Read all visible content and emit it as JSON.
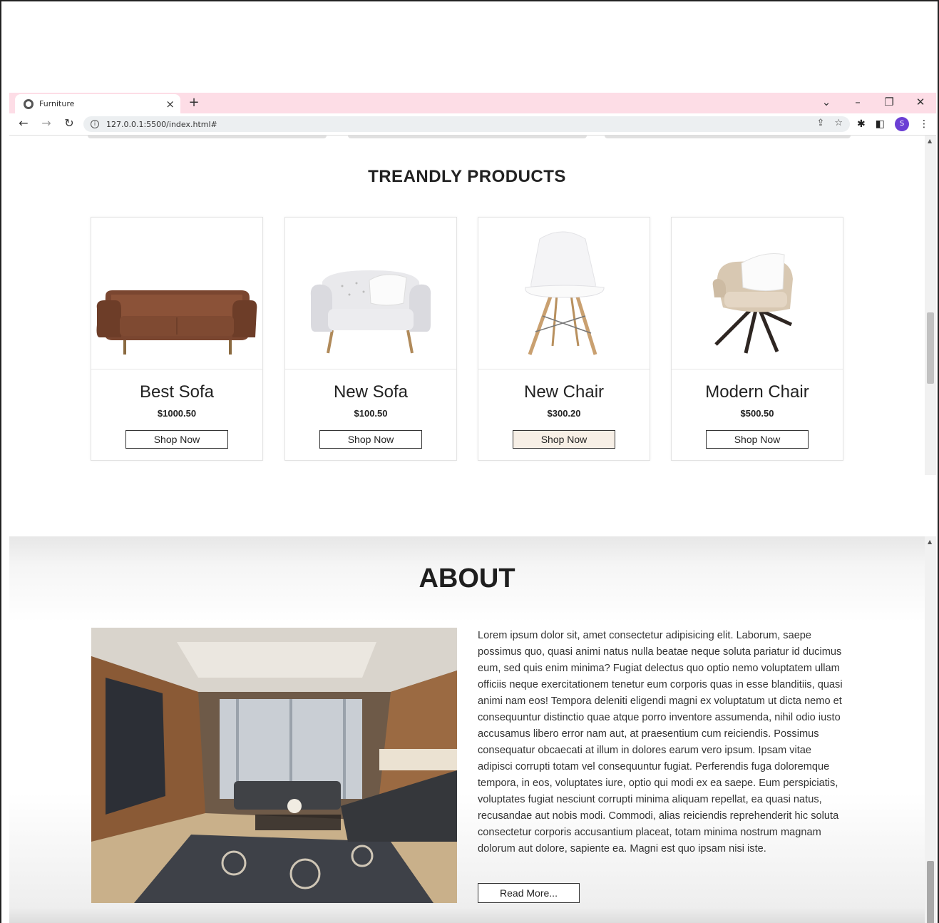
{
  "browser": {
    "tab_title": "Furniture",
    "tab_close": "×",
    "new_tab": "+",
    "url": "127.0.0.1:5500/index.html#",
    "avatar_letter": "S",
    "controls": {
      "dropdown": "⌄",
      "minimize": "–",
      "restore": "❐",
      "close": "✕"
    }
  },
  "products": {
    "title": "TREANDLY PRODUCTS",
    "items": [
      {
        "name": "Best Sofa",
        "price": "$1000.50",
        "button": "Shop Now"
      },
      {
        "name": "New Sofa",
        "price": "$100.50",
        "button": "Shop Now"
      },
      {
        "name": "New Chair",
        "price": "$300.20",
        "button": "Shop Now"
      },
      {
        "name": "Modern Chair",
        "price": "$500.50",
        "button": "Shop Now"
      }
    ]
  },
  "about": {
    "title": "ABOUT",
    "text": "Lorem ipsum dolor sit, amet consectetur adipisicing elit. Laborum, saepe possimus quo, quasi animi natus nulla beatae neque soluta pariatur id ducimus eum, sed quis enim minima? Fugiat delectus quo optio nemo voluptatem ullam officiis neque exercitationem tenetur eum corporis quas in esse blanditiis, quasi animi nam eos! Tempora deleniti eligendi magni ex voluptatum ut dicta nemo et consequuntur distinctio quae atque porro inventore assumenda, nihil odio iusto accusamus libero error nam aut, at praesentium cum reiciendis. Possimus consequatur obcaecati at illum in dolores earum vero ipsum. Ipsam vitae adipisci corrupti totam vel consequuntur fugiat. Perferendis fuga doloremque tempora, in eos, voluptates iure, optio qui modi ex ea saepe. Eum perspiciatis, voluptates fugiat nesciunt corrupti minima aliquam repellat, ea quasi natus, recusandae aut nobis modi. Commodi, alias reiciendis reprehenderit hic soluta consectetur corporis accusantium placeat, totam minima nostrum magnam dolorum aut dolore, sapiente ea. Magni est quo ipsam nisi iste.",
    "button": "Read More..."
  }
}
